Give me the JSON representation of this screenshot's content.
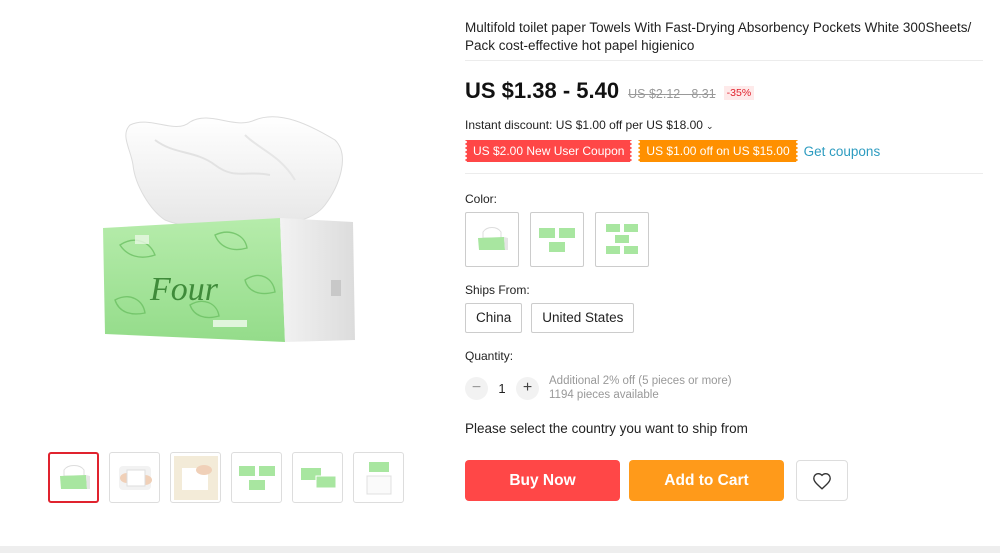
{
  "product": {
    "title": "Multifold toilet paper Towels With Fast-Drying Absorbency Pockets White 300Sheets/ Pack cost-effective hot papel higienico",
    "price": "US $1.38 - 5.40",
    "original_price": "US $2.12 - 8.31",
    "discount_badge": "-35%",
    "package_brand_text": "Four"
  },
  "promo": {
    "instant_discount": "Instant discount: US $1.00 off per US $18.00",
    "chevron": "⌄",
    "coupons": [
      "US $2.00 New User Coupon",
      "US $1.00 off on US $15.00"
    ],
    "get_coupons": "Get coupons"
  },
  "options": {
    "color_label": "Color:",
    "ships_from_label": "Ships From:",
    "ships_from": [
      "China",
      "United States"
    ],
    "quantity_label": "Quantity:",
    "quantity": "1",
    "minus": "−",
    "plus": "+",
    "additional_discount": "Additional 2% off (5 pieces or more)",
    "available": "1194 pieces available"
  },
  "ship_prompt": "Please select the country you want to ship from",
  "actions": {
    "buy_now": "Buy Now",
    "add_to_cart": "Add to Cart",
    "wishlist_icon": "heart-icon"
  },
  "colors": {
    "package_green": "#a8e6a0",
    "price_red": "#e0232e",
    "buy_now": "#ff4747",
    "add_to_cart": "#ff9a1a",
    "coupon_red": "#ff4747",
    "coupon_orange": "#ff9000",
    "link_blue": "#2e9cc0"
  }
}
